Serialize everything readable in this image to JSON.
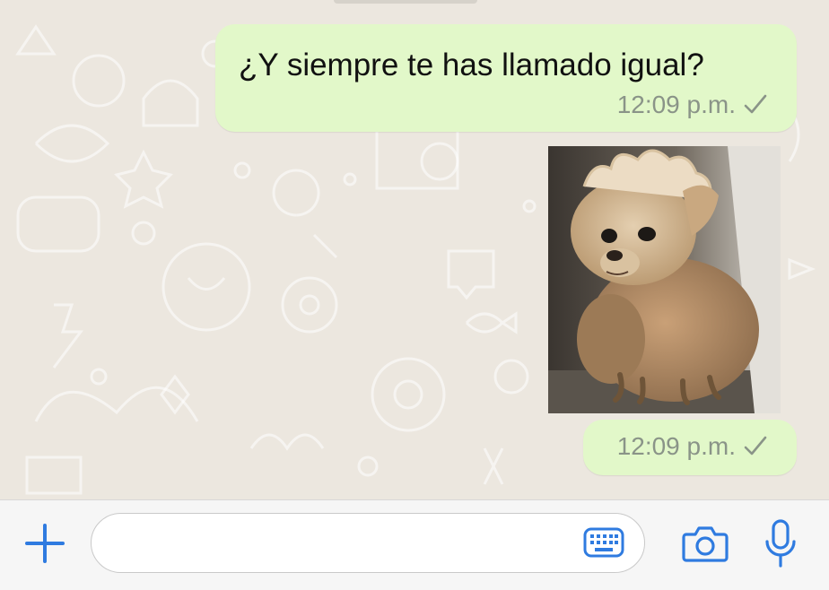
{
  "messages": [
    {
      "type": "text",
      "text": "¿Y siempre te has llamado igual?",
      "time": "12:09 p.m.",
      "status": "sent"
    },
    {
      "type": "sticker",
      "alt": "dog sticker",
      "time": "12:09 p.m.",
      "status": "sent"
    }
  ],
  "input": {
    "value": "",
    "placeholder": ""
  },
  "icons": {
    "attach": "plus-icon",
    "keyboard": "keyboard-icon",
    "camera": "camera-icon",
    "mic": "microphone-icon",
    "status": "checkmark-icon"
  },
  "colors": {
    "outgoing_bubble": "#e2f8c9",
    "accent": "#2f7be0",
    "chat_background": "#ece7df",
    "meta_text": "#8a9488"
  }
}
